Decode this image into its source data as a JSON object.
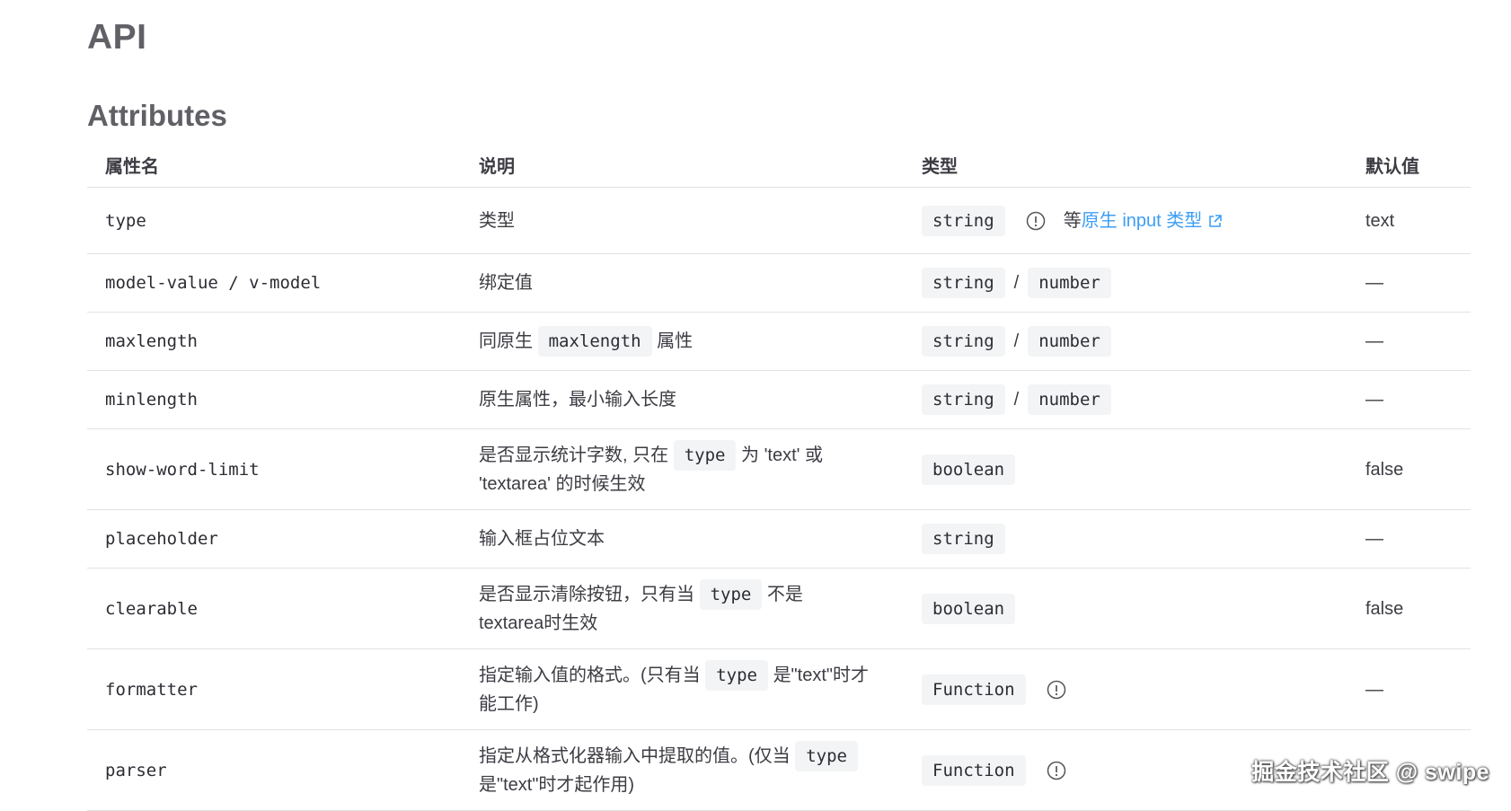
{
  "page_title": "API",
  "section_title": "Attributes",
  "headers": [
    "属性名",
    "说明",
    "类型",
    "默认值"
  ],
  "rows": {
    "r0": {
      "name": "type",
      "desc": "类型",
      "type1": "string",
      "type_pre": "等",
      "type_link": "原生 input 类型",
      "default": "text"
    },
    "r1": {
      "name": "model-value / v-model",
      "desc": "绑定值",
      "type1": "string",
      "sep": "/",
      "type2": "number",
      "default": "—"
    },
    "r2": {
      "name": "maxlength",
      "desc_a": "同原生",
      "desc_code": "maxlength",
      "desc_b": "属性",
      "type1": "string",
      "sep": "/",
      "type2": "number",
      "default": "—"
    },
    "r3": {
      "name": "minlength",
      "desc": "原生属性，最小输入长度",
      "type1": "string",
      "sep": "/",
      "type2": "number",
      "default": "—"
    },
    "r4": {
      "name": "show-word-limit",
      "desc_a": "是否显示统计字数, 只在",
      "desc_code": "type",
      "desc_b": "为 'text' 或 'textarea' 的时候生效",
      "type1": "boolean",
      "default": "false"
    },
    "r5": {
      "name": "placeholder",
      "desc": "输入框占位文本",
      "type1": "string",
      "default": "—"
    },
    "r6": {
      "name": "clearable",
      "desc_a": "是否显示清除按钮，只有当",
      "desc_code": "type",
      "desc_b": "不是 textarea时生效",
      "type1": "boolean",
      "default": "false"
    },
    "r7": {
      "name": "formatter",
      "desc_a": "指定输入值的格式。(只有当",
      "desc_code": "type",
      "desc_b": "是\"text\"时才能工作)",
      "type1": "Function",
      "default": "—"
    },
    "r8": {
      "name": "parser",
      "desc_a": "指定从格式化器输入中提取的值。(仅当",
      "desc_code": "type",
      "desc_b": "是\"text\"时才起作用)",
      "type1": "Function",
      "default": ""
    }
  },
  "icons": {
    "info": "info-circle-icon",
    "external": "external-link-icon"
  },
  "colors": {
    "link": "#3d9ef5",
    "code_bg": "#f3f4f5",
    "heading": "#606066"
  },
  "watermark": "掘金技术社区 @ swipe"
}
